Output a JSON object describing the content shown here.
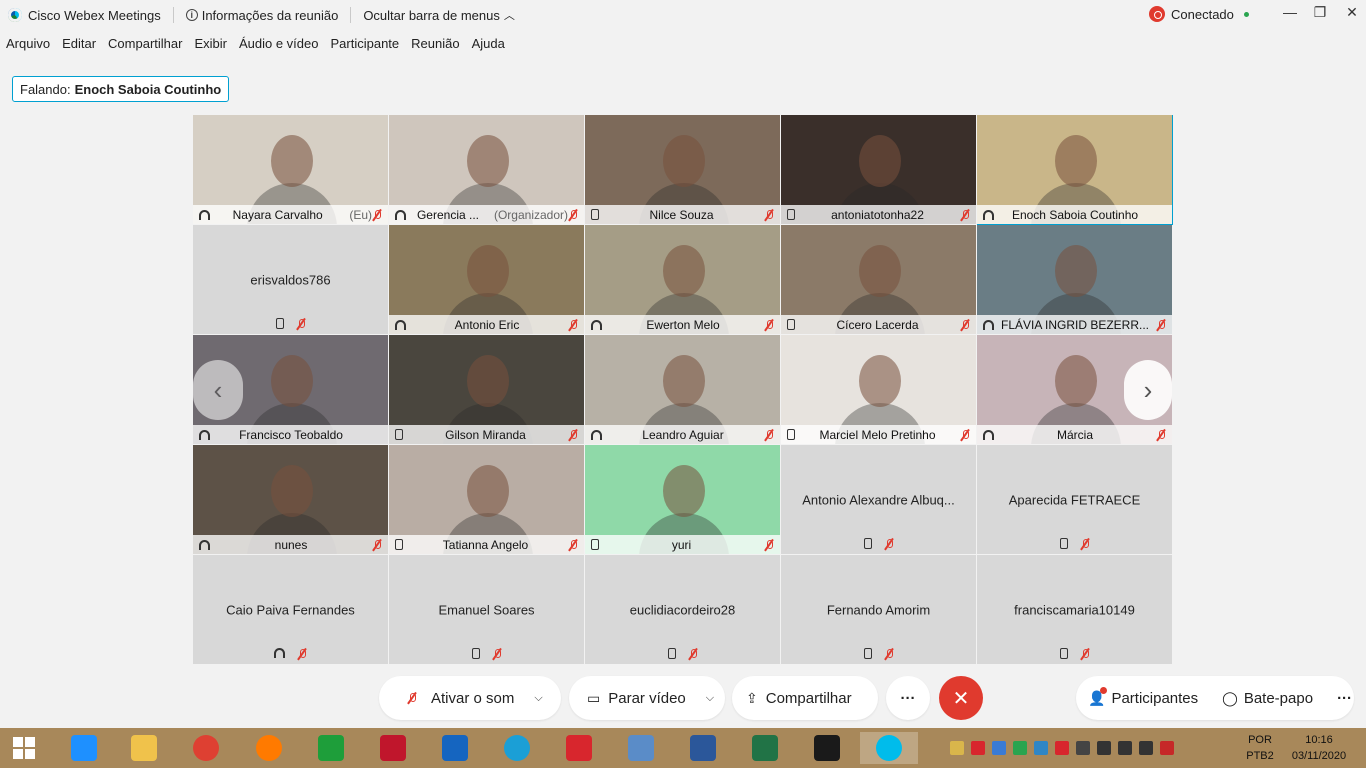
{
  "window": {
    "title": "Cisco Webex Meetings",
    "meeting_info": "Informações da reunião",
    "hide_menu": "Ocultar barra de menus",
    "status": "Conectado",
    "minimize": "—",
    "restore": "❐",
    "close": "✕"
  },
  "menu": [
    "Arquivo",
    "Editar",
    "Compartilhar",
    "Exibir",
    "Áudio e vídeo",
    "Participante",
    "Reunião",
    "Ajuda"
  ],
  "speaker": {
    "prefix": "Falando:",
    "name": "Enoch Saboia Coutinho"
  },
  "tiles": [
    {
      "name": "Nayara Carvalho",
      "suffix": "(Eu)",
      "video": true,
      "audio": "computer",
      "muted": true,
      "bg": "#d6cfc4"
    },
    {
      "name": "Gerencia ...",
      "suffix": "(Organizador)",
      "video": true,
      "audio": "computer",
      "muted": true,
      "bg": "#cfc6bd"
    },
    {
      "name": "Nilce Souza",
      "suffix": "",
      "video": true,
      "audio": "phone",
      "muted": true,
      "bg": "#7d6a5a"
    },
    {
      "name": "antoniatotonha22",
      "suffix": "",
      "video": true,
      "audio": "phone",
      "muted": true,
      "bg": "#3a2f2a"
    },
    {
      "name": "Enoch Saboia Coutinho",
      "suffix": "",
      "video": true,
      "audio": "computer",
      "muted": false,
      "active": true,
      "bg": "#c9b689"
    },
    {
      "name": "erisvaldos786",
      "suffix": "",
      "video": false,
      "audio": "phone",
      "muted": true
    },
    {
      "name": "Antonio Eric",
      "suffix": "",
      "video": true,
      "audio": "computer",
      "muted": true,
      "bg": "#8a7a5c"
    },
    {
      "name": "Ewerton Melo",
      "suffix": "",
      "video": true,
      "audio": "computer",
      "muted": true,
      "bg": "#a59d86"
    },
    {
      "name": "Cícero Lacerda",
      "suffix": "",
      "video": true,
      "audio": "phone",
      "muted": true,
      "bg": "#8b7a68"
    },
    {
      "name": "FLÁVIA INGRID BEZERR...",
      "suffix": "",
      "video": true,
      "audio": "computer",
      "muted": true,
      "bg": "#6a7d85"
    },
    {
      "name": "Francisco Teobaldo",
      "suffix": "",
      "video": true,
      "audio": "computer",
      "muted": false,
      "bg": "#6f6a70"
    },
    {
      "name": "Gilson Miranda",
      "suffix": "",
      "video": true,
      "audio": "phone",
      "muted": true,
      "bg": "#4a463e"
    },
    {
      "name": "Leandro Aguiar",
      "suffix": "",
      "video": true,
      "audio": "computer",
      "muted": true,
      "bg": "#b7b1a6"
    },
    {
      "name": "Marciel Melo Pretinho",
      "suffix": "",
      "video": true,
      "audio": "phone",
      "muted": true,
      "bg": "#e7e3de"
    },
    {
      "name": "Márcia",
      "suffix": "",
      "video": true,
      "audio": "computer",
      "muted": true,
      "bg": "#c7b4b8"
    },
    {
      "name": "nunes",
      "suffix": "",
      "video": true,
      "audio": "computer",
      "muted": true,
      "bg": "#5d5247"
    },
    {
      "name": "Tatianna Angelo",
      "suffix": "",
      "video": true,
      "audio": "phone",
      "muted": true,
      "bg": "#b9ada4"
    },
    {
      "name": "yuri",
      "suffix": "",
      "video": true,
      "audio": "phone",
      "muted": true,
      "bg": "#8fd9a8"
    },
    {
      "name": "Antonio Alexandre Albuq...",
      "suffix": "",
      "video": false,
      "audio": "phone",
      "muted": true
    },
    {
      "name": "Aparecida FETRAECE",
      "suffix": "",
      "video": false,
      "audio": "phone",
      "muted": true
    },
    {
      "name": "Caio Paiva Fernandes",
      "suffix": "",
      "video": false,
      "audio": "computer",
      "muted": true
    },
    {
      "name": "Emanuel Soares",
      "suffix": "",
      "video": false,
      "audio": "phone",
      "muted": true
    },
    {
      "name": "euclidiacordeiro28",
      "suffix": "",
      "video": false,
      "audio": "phone",
      "muted": true
    },
    {
      "name": "Fernando Amorim",
      "suffix": "",
      "video": false,
      "audio": "phone",
      "muted": true
    },
    {
      "name": "franciscamaria10149",
      "suffix": "",
      "video": false,
      "audio": "phone",
      "muted": true
    }
  ],
  "controls": {
    "unmute": "Ativar o som",
    "stop_video": "Parar vídeo",
    "share": "Compartilhar",
    "more": "···",
    "end": "✕",
    "participants": "Participantes",
    "chat": "Bate-papo",
    "overflow": "···"
  },
  "nav": {
    "prev": "‹",
    "next": "›"
  },
  "taskbar": {
    "apps": [
      {
        "name": "start-icon",
        "color": "#ffffff"
      },
      {
        "name": "internet-explorer-icon",
        "color": "#1e90ff"
      },
      {
        "name": "file-explorer-icon",
        "color": "#f0c24b"
      },
      {
        "name": "chrome-icon",
        "color": "#de4032"
      },
      {
        "name": "firefox-icon",
        "color": "#ff7a00"
      },
      {
        "name": "store-icon",
        "color": "#1e9e3a"
      },
      {
        "name": "antivirus-icon",
        "color": "#c0162c"
      },
      {
        "name": "defender-icon",
        "color": "#1565c0"
      },
      {
        "name": "edge-icon",
        "color": "#1b9fd6"
      },
      {
        "name": "shield-app-icon",
        "color": "#d8262d"
      },
      {
        "name": "photos-icon",
        "color": "#5a8cc8"
      },
      {
        "name": "word-icon",
        "color": "#2b579a"
      },
      {
        "name": "excel-icon",
        "color": "#217346"
      },
      {
        "name": "acrobat-icon",
        "color": "#1a1a1a"
      },
      {
        "name": "webex-icon",
        "color": "#00bceb"
      }
    ],
    "lang1": "POR",
    "lang2": "PTB2",
    "time": "10:16",
    "date": "03/11/2020"
  }
}
